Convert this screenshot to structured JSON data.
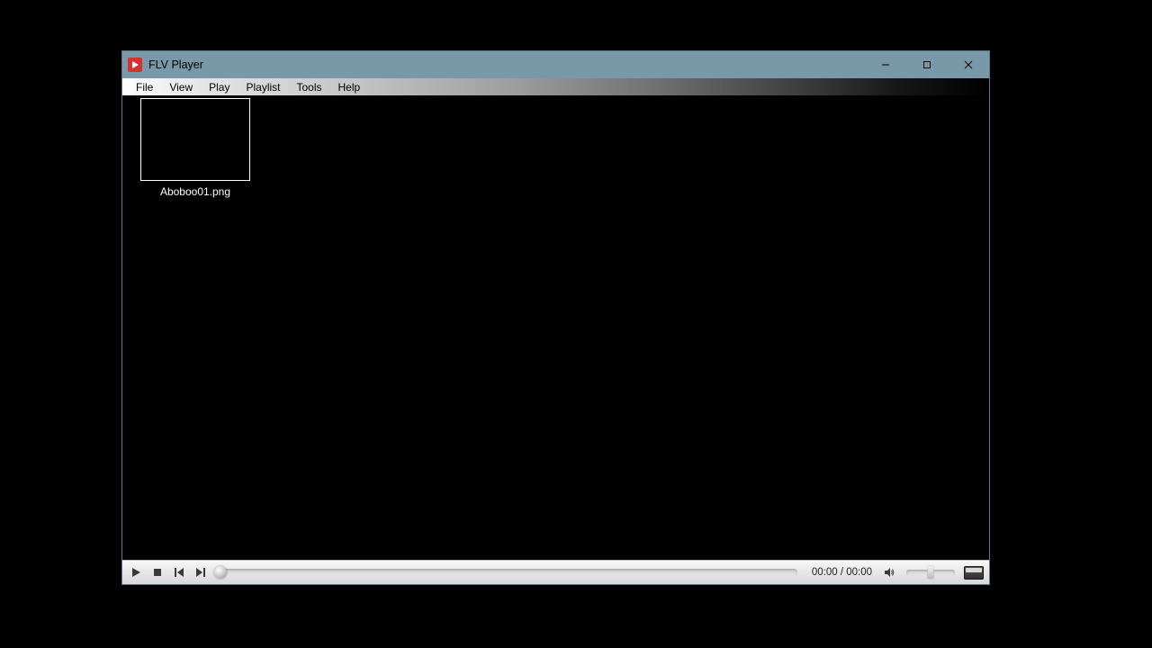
{
  "window": {
    "title": "FLV Player"
  },
  "menu": {
    "items": [
      "File",
      "View",
      "Play",
      "Playlist",
      "Tools",
      "Help"
    ]
  },
  "content": {
    "thumbnails": [
      {
        "label": "Aboboo01.png"
      }
    ]
  },
  "controls": {
    "time_display": "00:00 / 00:00",
    "volume_percent": 50
  }
}
